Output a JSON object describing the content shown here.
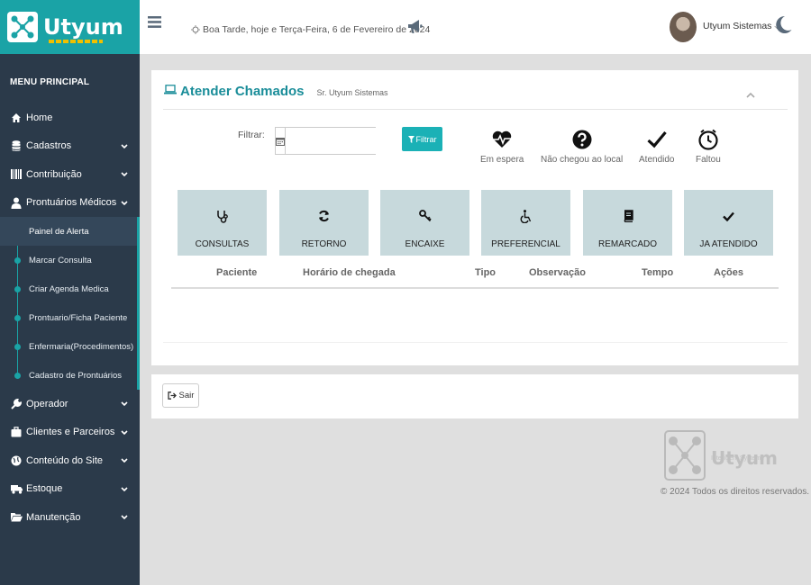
{
  "brand": {
    "name": "Utyum",
    "tagline": "Intelligent Systems"
  },
  "topbar": {
    "greeting": "Boa Tarde, hoje e Terça-Feira, 6 de Fevereiro de 2024",
    "user_name": "Utyum Sistemas"
  },
  "sidebar": {
    "title": "MENU PRINCIPAL",
    "items": [
      {
        "label": "Home",
        "icon": "home-icon"
      },
      {
        "label": "Cadastros",
        "icon": "database-icon"
      },
      {
        "label": "Contribuição",
        "icon": "barcode-icon"
      },
      {
        "label": "Prontuários Médicos",
        "icon": "user-md-icon"
      },
      {
        "label": "Operador",
        "icon": "wrench-icon"
      },
      {
        "label": "Clientes e Parceiros",
        "icon": "briefcase-icon"
      },
      {
        "label": "Conteúdo do Site",
        "icon": "globe-icon"
      },
      {
        "label": "Estoque",
        "icon": "truck-icon"
      },
      {
        "label": "Manutenção",
        "icon": "folder-open-icon"
      }
    ],
    "submenu": [
      "Painel de Alerta",
      "Marcar Consulta",
      "Criar Agenda Medica",
      "Prontuario/Ficha Paciente",
      "Enfermaria(Procedimentos)",
      "Cadastro de Prontuários"
    ]
  },
  "panel": {
    "title": "Atender Chamados",
    "subtitle": "Sr. Utyum Sistemas",
    "filter_label": "Filtrar:",
    "filter_value": "",
    "filter_button": "Filtrar"
  },
  "legend": [
    {
      "label": "Em espera",
      "icon": "heartbeat-icon"
    },
    {
      "label": "Não chegou ao local",
      "icon": "question-circle-icon"
    },
    {
      "label": "Atendido",
      "icon": "check-icon"
    },
    {
      "label": "Faltou",
      "icon": "clock-icon"
    }
  ],
  "categories": [
    {
      "label": "CONSULTAS",
      "icon": "stethoscope-icon"
    },
    {
      "label": "RETORNO",
      "icon": "refresh-icon"
    },
    {
      "label": "ENCAIXE",
      "icon": "key-icon"
    },
    {
      "label": "PREFERENCIAL",
      "icon": "wheelchair-icon"
    },
    {
      "label": "REMARCADO",
      "icon": "book-icon"
    },
    {
      "label": "JA ATENDIDO",
      "icon": "check-icon"
    }
  ],
  "table": {
    "columns": [
      "Paciente",
      "Horário de chegada",
      "Tipo",
      "Observação",
      "Tempo",
      "Ações"
    ]
  },
  "footer": {
    "exit_button": "Sair",
    "copyright": "© 2024 Todos os direitos reservados."
  },
  "colors": {
    "accent": "#1aa3a6",
    "sidebar": "#2b3a4a",
    "category_button": "#c7d9dc",
    "title": "#1a8d99"
  }
}
